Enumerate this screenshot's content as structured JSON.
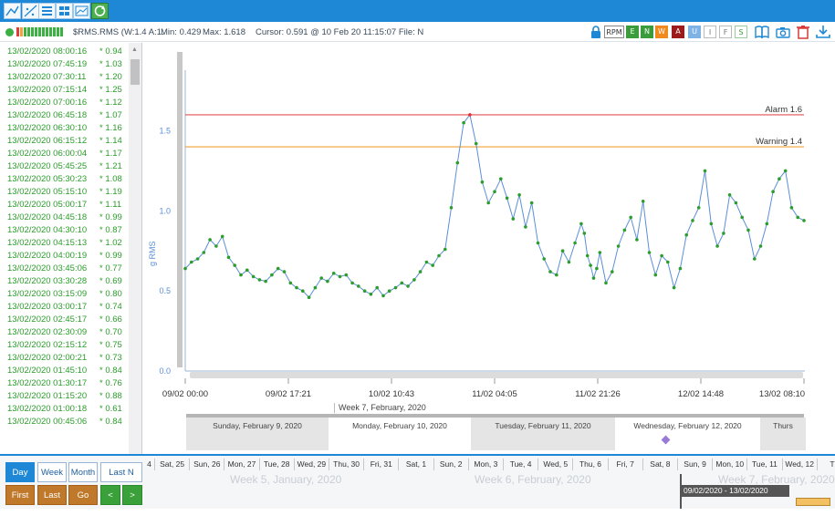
{
  "status": {
    "channel": "$RMS.RMS (W:1.4 A:1.",
    "min": "Min: 0.429",
    "max": "Max: 1.618",
    "cursor": "Cursor: 0.591 @ 10 Feb 20 11:15:07 File: N"
  },
  "filters": {
    "rpm": "RPM",
    "e": "E",
    "n": "N",
    "w": "W",
    "a": "A",
    "u": "U",
    "i": "I",
    "f": "F",
    "s": "S"
  },
  "log": [
    {
      "time": "13/02/2020 08:00:16",
      "value": "* 0.94"
    },
    {
      "time": "13/02/2020 07:45:19",
      "value": "* 1.03"
    },
    {
      "time": "13/02/2020 07:30:11",
      "value": "* 1.20"
    },
    {
      "time": "13/02/2020 07:15:14",
      "value": "* 1.25"
    },
    {
      "time": "13/02/2020 07:00:16",
      "value": "* 1.12"
    },
    {
      "time": "13/02/2020 06:45:18",
      "value": "* 1.07"
    },
    {
      "time": "13/02/2020 06:30:10",
      "value": "* 1.16"
    },
    {
      "time": "13/02/2020 06:15:12",
      "value": "* 1.14"
    },
    {
      "time": "13/02/2020 06:00:04",
      "value": "* 1.17"
    },
    {
      "time": "13/02/2020 05:45:25",
      "value": "* 1.21"
    },
    {
      "time": "13/02/2020 05:30:23",
      "value": "* 1.08"
    },
    {
      "time": "13/02/2020 05:15:10",
      "value": "* 1.19"
    },
    {
      "time": "13/02/2020 05:00:17",
      "value": "* 1.11"
    },
    {
      "time": "13/02/2020 04:45:18",
      "value": "* 0.99"
    },
    {
      "time": "13/02/2020 04:30:10",
      "value": "* 0.87"
    },
    {
      "time": "13/02/2020 04:15:13",
      "value": "* 1.02"
    },
    {
      "time": "13/02/2020 04:00:19",
      "value": "* 0.99"
    },
    {
      "time": "13/02/2020 03:45:06",
      "value": "* 0.77"
    },
    {
      "time": "13/02/2020 03:30:28",
      "value": "* 0.69"
    },
    {
      "time": "13/02/2020 03:15:09",
      "value": "* 0.80"
    },
    {
      "time": "13/02/2020 03:00:17",
      "value": "* 0.74"
    },
    {
      "time": "13/02/2020 02:45:17",
      "value": "* 0.66"
    },
    {
      "time": "13/02/2020 02:30:09",
      "value": "* 0.70"
    },
    {
      "time": "13/02/2020 02:15:12",
      "value": "* 0.75"
    },
    {
      "time": "13/02/2020 02:00:21",
      "value": "* 0.73"
    },
    {
      "time": "13/02/2020 01:45:10",
      "value": "* 0.84"
    },
    {
      "time": "13/02/2020 01:30:17",
      "value": "* 0.76"
    },
    {
      "time": "13/02/2020 01:15:20",
      "value": "* 0.88"
    },
    {
      "time": "13/02/2020 01:00:18",
      "value": "* 0.61"
    },
    {
      "time": "13/02/2020 00:45:06",
      "value": "* 0.84"
    }
  ],
  "chart_data": {
    "type": "scatter",
    "ylabel": "g RMS",
    "ylim": [
      0,
      1.85
    ],
    "yticks": [
      "0.0",
      "0.5",
      "1.0",
      "1.5"
    ],
    "xticks": [
      "09/02 00:00",
      "09/02 17:21",
      "10/02 10:43",
      "11/02 04:05",
      "11/02 21:26",
      "12/02 14:48",
      "13/02 08:10"
    ],
    "alarm": {
      "label": "Alarm 1.6",
      "value": 1.6,
      "color": "#e05050"
    },
    "warning": {
      "label": "Warning 1.4",
      "value": 1.4,
      "color": "#f0a030"
    },
    "colors": {
      "line": "#5b8fd8",
      "point": "#2a9d2a",
      "peak": "#e03030"
    },
    "x": [
      0,
      0.01,
      0.02,
      0.03,
      0.04,
      0.05,
      0.06,
      0.07,
      0.08,
      0.09,
      0.1,
      0.11,
      0.12,
      0.13,
      0.14,
      0.15,
      0.16,
      0.17,
      0.18,
      0.19,
      0.2,
      0.21,
      0.22,
      0.23,
      0.24,
      0.25,
      0.26,
      0.27,
      0.28,
      0.29,
      0.3,
      0.31,
      0.32,
      0.33,
      0.34,
      0.35,
      0.36,
      0.37,
      0.38,
      0.39,
      0.4,
      0.41,
      0.42,
      0.43,
      0.44,
      0.45,
      0.46,
      0.47,
      0.48,
      0.49,
      0.5,
      0.51,
      0.52,
      0.53,
      0.54,
      0.55,
      0.56,
      0.57,
      0.58,
      0.59,
      0.6,
      0.61,
      0.62,
      0.63,
      0.64,
      0.645,
      0.65,
      0.655,
      0.66,
      0.665,
      0.67,
      0.68,
      0.69,
      0.7,
      0.71,
      0.72,
      0.73,
      0.74,
      0.75,
      0.76,
      0.77,
      0.78,
      0.79,
      0.8,
      0.81,
      0.82,
      0.83,
      0.84,
      0.85,
      0.86,
      0.87,
      0.88,
      0.89,
      0.9,
      0.91,
      0.92,
      0.93,
      0.94,
      0.95,
      0.96,
      0.97,
      0.98,
      0.99,
      1.0
    ],
    "y": [
      0.64,
      0.68,
      0.7,
      0.74,
      0.82,
      0.78,
      0.84,
      0.71,
      0.66,
      0.6,
      0.63,
      0.59,
      0.57,
      0.56,
      0.6,
      0.64,
      0.62,
      0.55,
      0.52,
      0.5,
      0.46,
      0.52,
      0.58,
      0.56,
      0.61,
      0.59,
      0.6,
      0.55,
      0.53,
      0.5,
      0.48,
      0.52,
      0.47,
      0.5,
      0.52,
      0.55,
      0.53,
      0.57,
      0.62,
      0.68,
      0.66,
      0.72,
      0.76,
      1.02,
      1.3,
      1.55,
      1.6,
      1.42,
      1.18,
      1.05,
      1.12,
      1.2,
      1.08,
      0.95,
      1.1,
      0.9,
      1.05,
      0.8,
      0.7,
      0.62,
      0.6,
      0.75,
      0.68,
      0.8,
      0.92,
      0.86,
      0.72,
      0.66,
      0.58,
      0.64,
      0.74,
      0.55,
      0.62,
      0.78,
      0.88,
      0.96,
      0.82,
      1.06,
      0.74,
      0.6,
      0.72,
      0.68,
      0.52,
      0.64,
      0.85,
      0.94,
      1.02,
      1.25,
      0.92,
      0.78,
      0.86,
      1.1,
      1.05,
      0.96,
      0.88,
      0.7,
      0.78,
      0.92,
      1.12,
      1.2,
      1.25,
      1.02,
      0.96,
      0.94
    ]
  },
  "timeline": {
    "week_header": "Week 7, February, 2020",
    "days": [
      "Sunday, February 9, 2020",
      "Monday, February 10, 2020",
      "Tuesday, February 11, 2020",
      "Wednesday, February 12, 2020",
      "Thurs"
    ]
  },
  "navigation": {
    "day": "Day",
    "week": "Week",
    "month": "Month",
    "last_n": "Last N",
    "first": "First",
    "last": "Last",
    "goto": "Go To...",
    "prev": "<",
    "next": ">"
  },
  "calendar": {
    "days": [
      "4",
      "Sat, 25",
      "Sun, 26",
      "Mon, 27",
      "Tue, 28",
      "Wed, 29",
      "Thu, 30",
      "Fri, 31",
      "Sat, 1",
      "Sun, 2",
      "Mon, 3",
      "Tue, 4",
      "Wed, 5",
      "Thu, 6",
      "Fri, 7",
      "Sat, 8",
      "Sun, 9",
      "Mon, 10",
      "Tue, 11",
      "Wed, 12",
      "Th"
    ],
    "weeks": [
      "Week 5, January, 2020",
      "Week 6, February, 2020",
      "Week 7, February, 2020"
    ],
    "range": "09/02/2020 - 13/02/2020"
  }
}
